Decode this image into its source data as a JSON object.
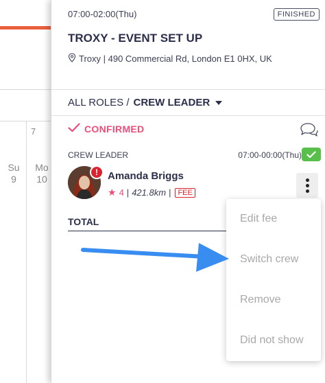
{
  "background": {
    "week_number": "7",
    "days": [
      {
        "name": "Su",
        "date": "9"
      },
      {
        "name": "Mo",
        "date": "10"
      }
    ]
  },
  "event": {
    "time": "07:00-02:00(Thu)",
    "status": "FINISHED",
    "title": "TROXY - EVENT SET UP",
    "location_icon": "map-pin-icon",
    "location": "Troxy | 490 Commercial Rd, London E1 0HX, UK"
  },
  "roles": {
    "all_label": "ALL ROLES /",
    "selected": "CREW LEADER"
  },
  "confirmed": {
    "label": "CONFIRMED",
    "color": "#ec4e7a"
  },
  "crew": {
    "role": "CREW LEADER",
    "time": "07:00-00:00(Thu)",
    "alert": "!",
    "name": "Amanda Briggs",
    "rating": "4",
    "distance": "421.8km",
    "fee_badge": "FEE"
  },
  "total_label": "TOTAL",
  "menu": {
    "items": [
      "Edit fee",
      "Switch crew",
      "Remove",
      "Did not show"
    ]
  },
  "colors": {
    "accent": "#ec4e7a",
    "success": "#58c04a",
    "alert": "#d9232e",
    "arrow": "#3a8df0"
  }
}
